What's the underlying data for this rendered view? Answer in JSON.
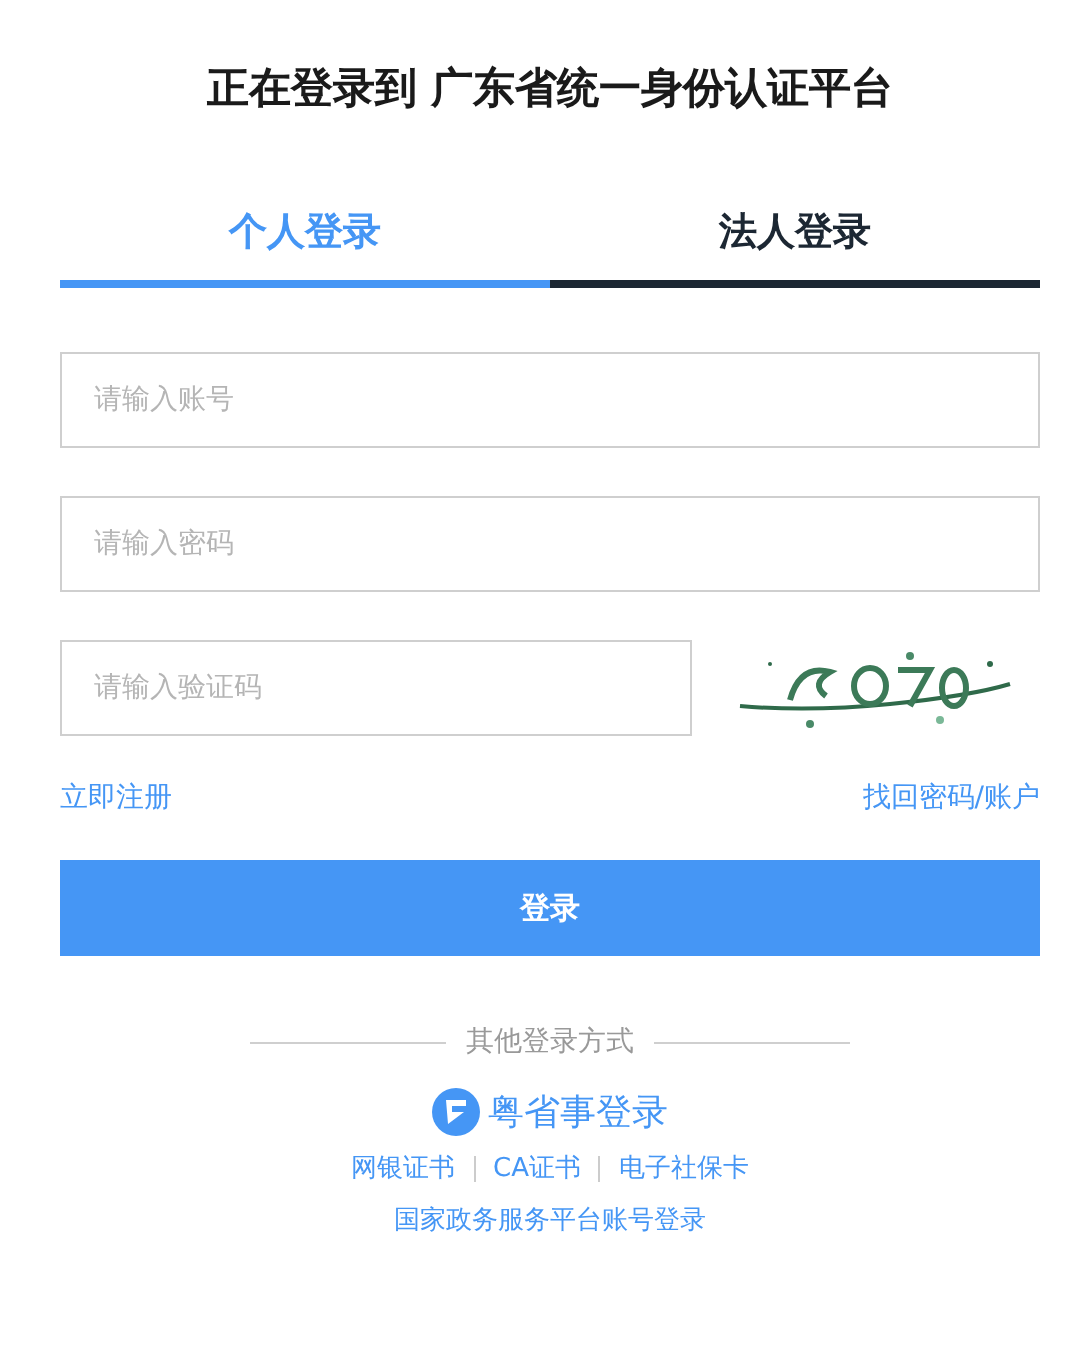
{
  "title": "正在登录到 广东省统一身份认证平台",
  "tabs": [
    {
      "label": "个人登录",
      "selected": true
    },
    {
      "label": "法人登录",
      "selected": false
    }
  ],
  "fields": [
    {
      "placeholder": "请输入账号",
      "kind": "text"
    },
    {
      "placeholder": "请输入密码",
      "kind": "password"
    },
    {
      "placeholder": "请输入验证码",
      "kind": "captcha"
    }
  ],
  "register_link": "立即注册",
  "recover_link": "找回密码/账户",
  "login_button": "登录",
  "other_methods": "其他登录方式",
  "app_login": "粤省事登录",
  "alt_links": [
    "网银证书",
    "CA证书",
    "电子社保卡"
  ],
  "national_login": "国家政务服务平台账号登录"
}
